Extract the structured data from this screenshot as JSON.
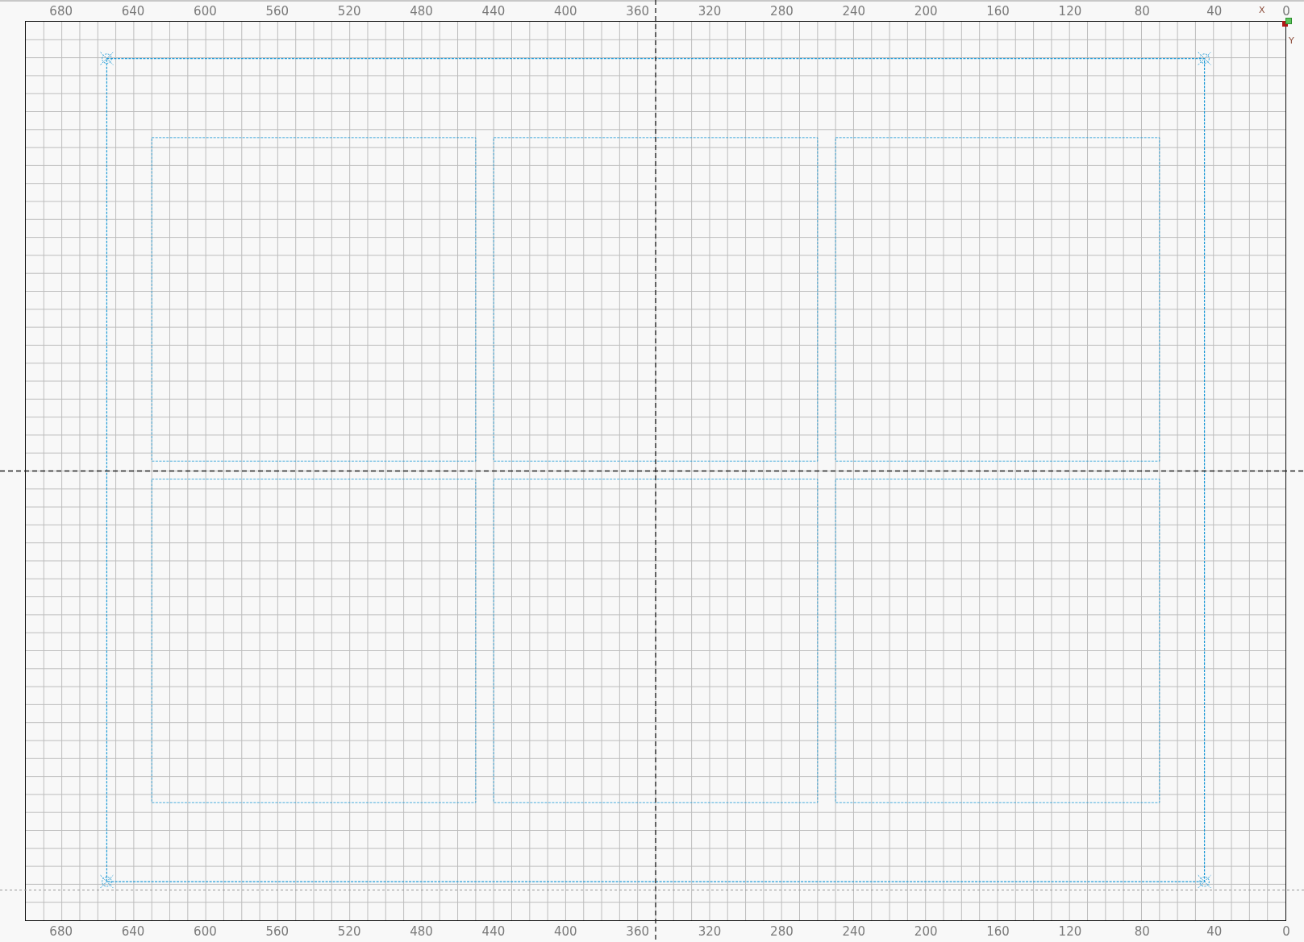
{
  "ruler_top": {
    "labels": [
      "680",
      "640",
      "600",
      "560",
      "520",
      "480",
      "440",
      "400",
      "360",
      "320",
      "280",
      "240",
      "200",
      "160",
      "120",
      "80",
      "40",
      "0"
    ]
  },
  "ruler_bottom": {
    "labels": [
      "680",
      "640",
      "600",
      "560",
      "520",
      "480",
      "440",
      "400",
      "360",
      "320",
      "280",
      "240",
      "200",
      "160",
      "120",
      "80",
      "40",
      "0"
    ]
  },
  "axis_labels": {
    "x": "X",
    "y": "Y"
  }
}
